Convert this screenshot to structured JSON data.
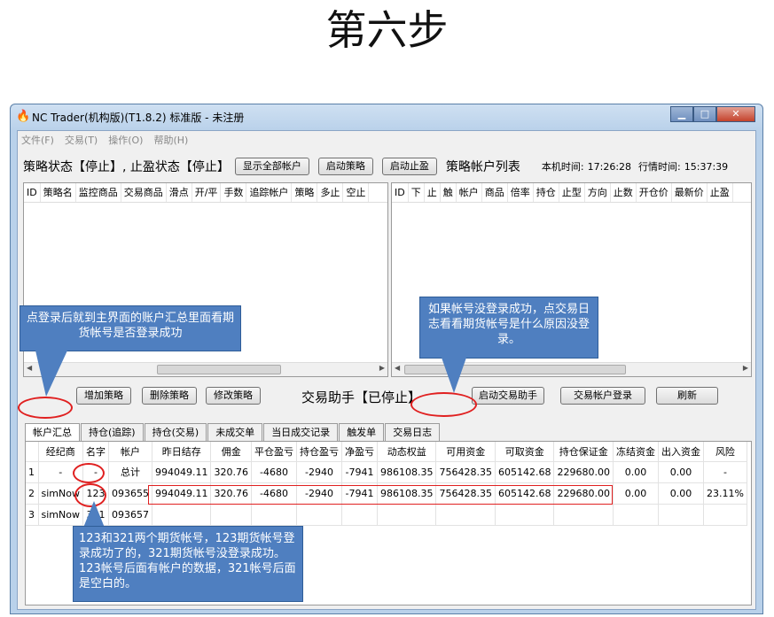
{
  "slide": {
    "title": "第六步"
  },
  "window": {
    "title": "NC Trader(机构版)(T1.8.2) 标准版 - 未注册",
    "controls": {
      "minimize": "▁",
      "maximize": "□",
      "close": "✕"
    }
  },
  "menu": [
    "文件(F)",
    "交易(T)",
    "操作(O)",
    "帮助(H)"
  ],
  "toolbar": {
    "status_text": "策略状态【停止】, 止盈状态【停止】",
    "show_all_accounts": "显示全部帐户",
    "start_strategy": "启动策略",
    "start_takeprofit": "启动止盈",
    "list_title": "策略帐户列表",
    "local_time_label": "本机时间:",
    "local_time": "17:26:28",
    "quote_time_label": "行情时间:",
    "quote_time": "15:37:39"
  },
  "left_pane": {
    "columns": [
      "ID",
      "策略名",
      "监控商品",
      "交易商品",
      "滑点",
      "开/平",
      "手数",
      "追踪帐户",
      "策略",
      "多止",
      "空止"
    ]
  },
  "right_pane": {
    "columns": [
      "ID",
      "下",
      "止",
      "触",
      "帐户",
      "商品",
      "倍率",
      "持仓",
      "止型",
      "方向",
      "止数",
      "开仓价",
      "最新价",
      "止盈"
    ]
  },
  "actions": {
    "add_strategy": "增加策略",
    "delete_strategy": "删除策略",
    "modify_strategy": "修改策略",
    "helper_status": "交易助手【已停止】",
    "start_helper": "启动交易助手",
    "account_login": "交易帐户登录",
    "refresh": "刷新"
  },
  "tabs": [
    "帐户汇总",
    "持仓(追踪)",
    "持仓(交易)",
    "未成交单",
    "当日成交记录",
    "触发单",
    "交易日志"
  ],
  "table": {
    "columns": [
      "",
      "经纪商",
      "名字",
      "帐户",
      "昨日结存",
      "佣金",
      "平仓盈亏",
      "持仓盈亏",
      "净盈亏",
      "动态权益",
      "可用资金",
      "可取资金",
      "持仓保证金",
      "冻结资金",
      "出入资金",
      "风险"
    ],
    "rows": [
      [
        "1",
        "-",
        "-",
        "总计",
        "994049.11",
        "320.76",
        "-4680",
        "-2940",
        "-7941",
        "986108.35",
        "756428.35",
        "605142.68",
        "229680.00",
        "0.00",
        "0.00",
        "-"
      ],
      [
        "2",
        "simNow",
        "123",
        "093655",
        "994049.11",
        "320.76",
        "-4680",
        "-2940",
        "-7941",
        "986108.35",
        "756428.35",
        "605142.68",
        "229680.00",
        "0.00",
        "0.00",
        "23.11%"
      ],
      [
        "3",
        "simNow",
        "321",
        "093657",
        "",
        "",
        "",
        "",
        "",
        "",
        "",
        "",
        "",
        "",
        "",
        ""
      ]
    ]
  },
  "callouts": {
    "left": "点登录后就到主界面的账户汇总里面看期货帐号是否登录成功",
    "right": "如果帐号没登录成功，点交易日志看看期货帐号是什么原因没登录。",
    "bottom": "123和321两个期货帐号，123期货帐号登录成功了的，321期货帐号没登录成功。123帐号后面有帐户的数据，321帐号后面是空白的。"
  },
  "colors": {
    "callout_bg": "#4f7fc0",
    "highlight": "#e02020",
    "window_frame": "#b9d1ea"
  }
}
